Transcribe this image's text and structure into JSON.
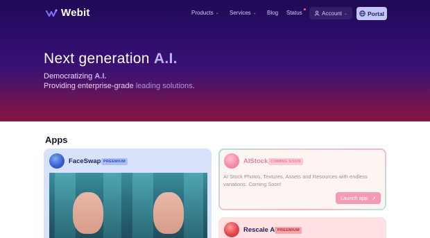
{
  "brand": {
    "name": "Webit"
  },
  "nav": {
    "products": "Products",
    "services": "Services",
    "blog": "Blog",
    "status": "Status",
    "account": "Account",
    "portal": "Portal"
  },
  "hero": {
    "title_pre": "Next generation ",
    "title_accent": "A.I.",
    "line1_pre": "Democratizing ",
    "line1_accent": "A.I.",
    "line2_pre": "Providing enterprise-grade ",
    "line2_accent": "leading solutions",
    "line2_post": "."
  },
  "apps": {
    "heading": "Apps",
    "faceswap": {
      "name": "FaceSwap",
      "badge": "PREEMIUM"
    },
    "aistock": {
      "name": "AIStock",
      "badge": "COMING SOON",
      "description": "AI Stock Photos, Textures, Assets and Resources with endless variations. Coming Soon!",
      "launch_label": "Launch app"
    },
    "rescale": {
      "name": "Rescale AI",
      "badge": "PREEMIUM"
    }
  },
  "colors": {
    "accent": "#b9b4f2",
    "portal_bg": "#c3c6f7",
    "launch_bg": "#f59bb8"
  }
}
